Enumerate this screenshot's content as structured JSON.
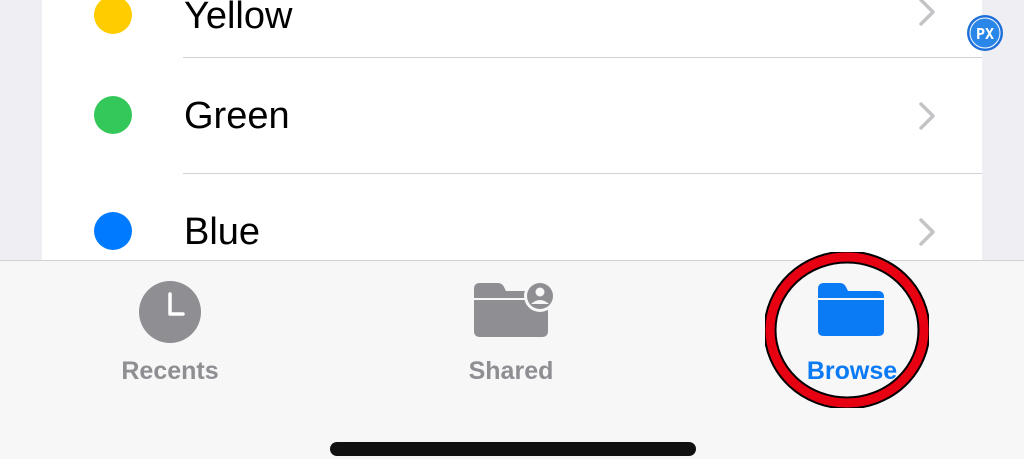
{
  "colors": {
    "yellow": "#ffcc00",
    "green": "#34c759",
    "blue": "#007aff",
    "tab_inactive": "#8e8e93",
    "tab_active": "#0a7af5",
    "highlight_ring": "#e60012"
  },
  "tags": [
    {
      "label": "Yellow",
      "color": "#ffcc00"
    },
    {
      "label": "Green",
      "color": "#34c759"
    },
    {
      "label": "Blue",
      "color": "#007aff"
    }
  ],
  "tabbar": {
    "tabs": [
      {
        "label": "Recents",
        "icon": "clock-icon",
        "active": false
      },
      {
        "label": "Shared",
        "icon": "shared-folder-icon",
        "active": false
      },
      {
        "label": "Browse",
        "icon": "folder-icon",
        "active": true
      }
    ]
  },
  "watermark": {
    "text": "PX"
  }
}
